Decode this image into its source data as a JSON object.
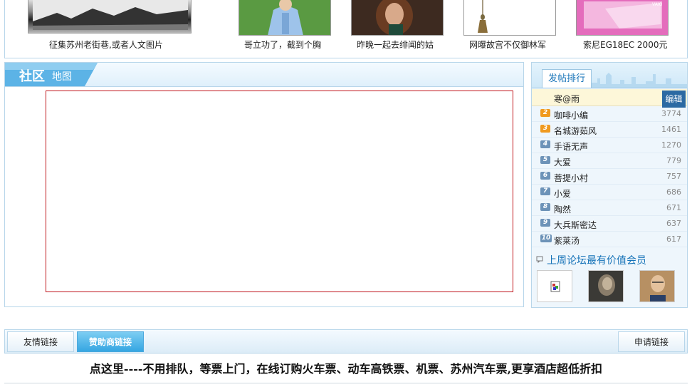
{
  "photos": [
    {
      "caption": "征集苏州老街巷,或者人文图片",
      "image": "old-street-photo"
    },
    {
      "caption": "哥立功了，截到个胸",
      "image": "woman-shirt-photo"
    },
    {
      "caption": "昨晚一起去绯闻的姑",
      "image": "woman-portrait-photo"
    },
    {
      "caption": "网曝故宫不仅御林军",
      "image": "tassel-ornament-photo"
    },
    {
      "caption": "索尼EG18EC 2000元",
      "image": "pink-laptop-photo"
    }
  ],
  "community_map": {
    "title": "社区",
    "subtitle": "地图"
  },
  "ranking": {
    "tab_label": "发帖排行",
    "edit_label": "编辑",
    "top_user": "寒@雨",
    "rows": [
      {
        "rank": "2",
        "name": "咖啡小编",
        "count": "3774",
        "color": "#f09a1f"
      },
      {
        "rank": "3",
        "name": "名城游茹风",
        "count": "1461",
        "color": "#f09a1f"
      },
      {
        "rank": "4",
        "name": "手语无声",
        "count": "1270",
        "color": "#6d93b8"
      },
      {
        "rank": "5",
        "name": "大爱",
        "count": "779",
        "color": "#6d93b8"
      },
      {
        "rank": "6",
        "name": "菩提小村",
        "count": "757",
        "color": "#6d93b8"
      },
      {
        "rank": "7",
        "name": "小爱",
        "count": "686",
        "color": "#6d93b8"
      },
      {
        "rank": "8",
        "name": "陶然",
        "count": "671",
        "color": "#6d93b8"
      },
      {
        "rank": "9",
        "name": "大兵斯密达",
        "count": "637",
        "color": "#6d93b8"
      },
      {
        "rank": "10",
        "name": "紫莱汤",
        "count": "617",
        "color": "#6d93b8"
      }
    ],
    "vip_title": "上周论坛最有价值会员",
    "vip_avatars": [
      "broken-image-avatar",
      "dark-portrait-avatar",
      "man-glasses-avatar"
    ]
  },
  "links": {
    "friend_links": "友情链接",
    "sponsor_links": "赞助商链接",
    "apply_link": "申请链接"
  },
  "promo_text": "点这里----不用排队，等票上门，在线订购火车票、动车高铁票、机票、苏州汽车票,更享酒店超低折扣",
  "colors": {
    "accent_blue": "#1673b8",
    "border_blue": "#b8d6ea",
    "map_border_red": "#c0161c",
    "active_tab": "#35a6e2"
  }
}
